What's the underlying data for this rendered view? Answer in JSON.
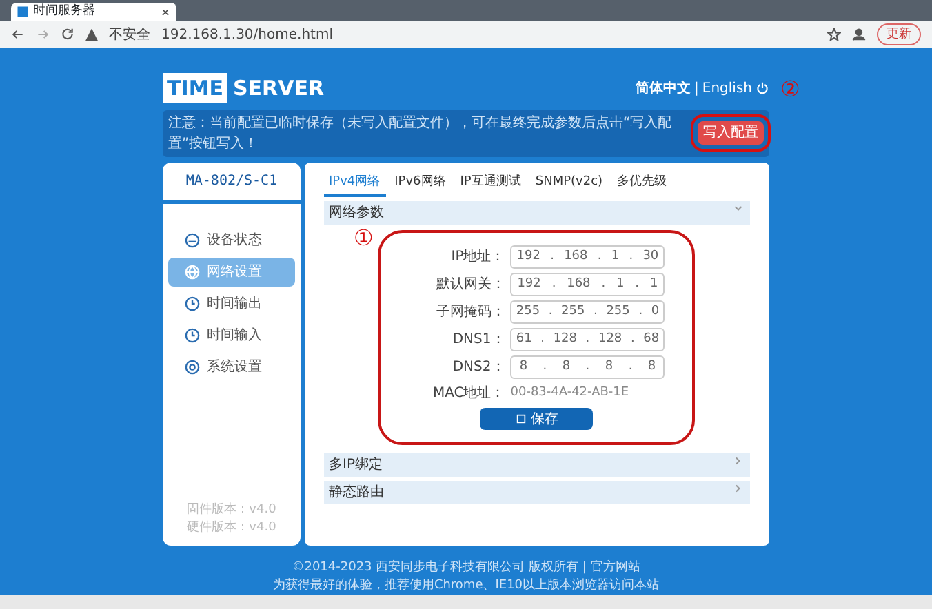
{
  "browser": {
    "tab_title": "时间服务器",
    "url_warning": "不安全",
    "url": "192.168.1.30/home.html",
    "update_button": "更新"
  },
  "header": {
    "logo_left": "TIME",
    "logo_right": "SERVER",
    "separator": "|",
    "languages": [
      {
        "label": "简体中文",
        "selected": true
      },
      {
        "label": "English",
        "selected": false
      }
    ]
  },
  "notice": {
    "text": "注意：当前配置已临时保存（未写入配置文件），可在最终完成参数后点击“写入配置”按钮写入！",
    "write_button": "写入配置"
  },
  "sidebar": {
    "model": "MA-802/S-C1",
    "items": [
      {
        "label": "设备状态",
        "kind": "gauge",
        "selected": false
      },
      {
        "label": "网络设置",
        "kind": "globe",
        "selected": true
      },
      {
        "label": "时间输出",
        "kind": "clock",
        "selected": false
      },
      {
        "label": "时间输入",
        "kind": "clock",
        "selected": false
      },
      {
        "label": "系统设置",
        "kind": "gear",
        "selected": false
      }
    ],
    "versions": [
      "固件版本：v4.0",
      "硬件版本：v4.0"
    ]
  },
  "tabs": [
    {
      "label": "IPv4网络",
      "selected": true
    },
    {
      "label": "IPv6网络",
      "selected": false
    },
    {
      "label": "IP互通测试",
      "selected": false
    },
    {
      "label": "SNMP(v2c)",
      "selected": false
    },
    {
      "label": "多优先级",
      "selected": false
    }
  ],
  "sections": [
    {
      "title": "网络参数",
      "expanded": true,
      "octet_separator": ".",
      "fields": [
        {
          "label": "IP地址：",
          "octets": [
            "192",
            "168",
            "1",
            "30"
          ]
        },
        {
          "label": "默认网关：",
          "octets": [
            "192",
            "168",
            "1",
            "1"
          ]
        },
        {
          "label": "子网掩码：",
          "octets": [
            "255",
            "255",
            "255",
            "0"
          ]
        },
        {
          "label": "DNS1：",
          "octets": [
            "61",
            "128",
            "128",
            "68"
          ]
        },
        {
          "label": "DNS2：",
          "octets": [
            "8",
            "8",
            "8",
            "8"
          ]
        }
      ],
      "mac_label": "MAC地址：",
      "mac_value": "00-83-4A-42-AB-1E",
      "save_button": "保存"
    },
    {
      "title": "多IP绑定",
      "expanded": false
    },
    {
      "title": "静态路由",
      "expanded": false
    }
  ],
  "footer": [
    "©2014-2023 西安同步电子科技有限公司 版权所有 | 官方网站",
    "为获得最好的体验，推荐使用Chrome、IE10以上版本浏览器访问本站"
  ],
  "annotations": [
    {
      "label": "①"
    },
    {
      "label": "②"
    }
  ]
}
